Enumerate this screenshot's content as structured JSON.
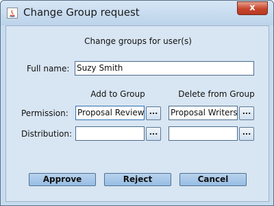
{
  "window": {
    "title": "Change Group request",
    "close_label": "x"
  },
  "form": {
    "heading": "Change groups for user(s)",
    "full_name_label": "Full name:",
    "full_name_value": "Suzy Smith",
    "add_group_header": "Add to Group",
    "delete_group_header": "Delete from Group",
    "permission_label": "Permission:",
    "distribution_label": "Distribution:",
    "permission_add_value": "Proposal Reviewers",
    "permission_delete_value": "Proposal Writers",
    "distribution_add_value": "",
    "distribution_delete_value": "",
    "browse_label": "..."
  },
  "buttons": {
    "approve": "Approve",
    "reject": "Reject",
    "cancel": "Cancel"
  }
}
